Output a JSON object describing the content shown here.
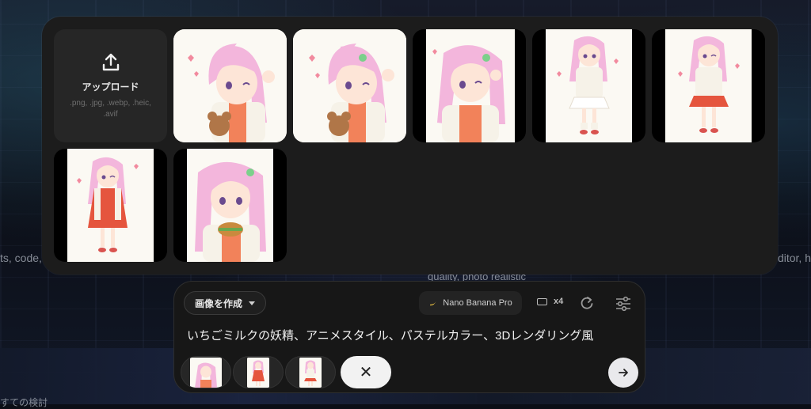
{
  "background": {
    "left_text": "ts, code,",
    "right_text": "ditor, h",
    "mid_text": "quality, photo realistic",
    "bottom_text": "すての検討"
  },
  "gallery": {
    "upload": {
      "label": "アップロード",
      "formats": ".png, .jpg, .webp, .heic, .avif",
      "icon": "upload-icon"
    },
    "images": [
      {
        "pose": "peace-sign",
        "outfit": "white-jacket-orange-top",
        "holding": "teddy-bear",
        "framing": "closeup"
      },
      {
        "pose": "peace-sign-wink",
        "outfit": "white-jacket-orange-top",
        "holding": "teddy-bear",
        "framing": "closeup"
      },
      {
        "pose": "peace-sign-wink",
        "outfit": "white-jacket-orange-dotted",
        "holding": "",
        "framing": "closeup"
      },
      {
        "pose": "standing",
        "outfit": "white-jacket-white-skirt",
        "holding": "",
        "framing": "full-body"
      },
      {
        "pose": "wink",
        "outfit": "white-jacket-red-skirt",
        "holding": "",
        "framing": "full-body"
      },
      {
        "pose": "wink",
        "outfit": "white-jacket-red-dotted-dress",
        "holding": "",
        "framing": "full-body"
      },
      {
        "pose": "eating",
        "outfit": "white-jacket-orange-top",
        "holding": "burger",
        "framing": "closeup"
      }
    ]
  },
  "prompt_bar": {
    "mode_label": "画像を作成",
    "model_label": "Nano Banana Pro",
    "count_label": "x4",
    "prompt_text": "いちごミルクの妖精、アニメスタイル、パステルカラー、3Dレンダリング風",
    "thumbnail_count": 3
  },
  "colors": {
    "panel": "#1c1c1c",
    "prompt_bg": "#171717",
    "hair": "#f3b6dc",
    "jacket": "#f6f2e8",
    "accent_orange": "#f07a4e",
    "heart": "#f28a9e"
  }
}
